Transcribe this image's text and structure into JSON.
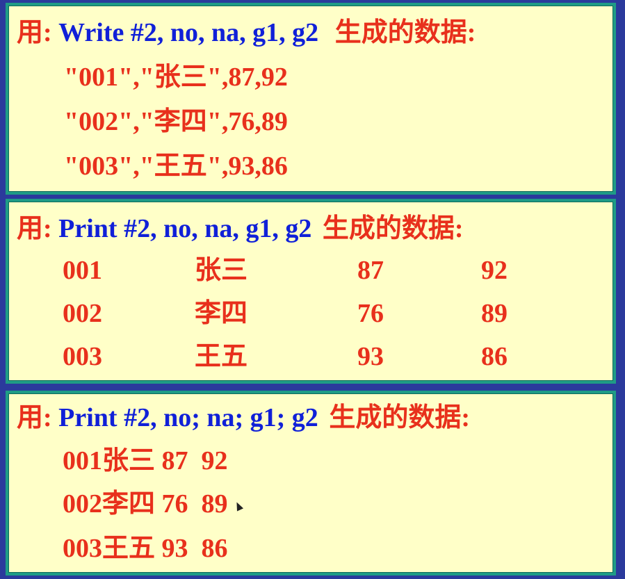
{
  "panels": [
    {
      "prefix": "用:",
      "command": "Write #2, no, na, g1, g2",
      "suffix": "生成的数据:",
      "lines": [
        "\"001\",\"张三\",87,92",
        "\"002\",\"李四\",76,89",
        "\"003\",\"王五\",93,86"
      ]
    },
    {
      "prefix": "用:",
      "command": "Print #2, no, na, g1, g2",
      "suffix": "生成的数据:",
      "rows": [
        [
          "001",
          "张三",
          "87",
          "92"
        ],
        [
          "002",
          "李四",
          "76",
          "89"
        ],
        [
          "003",
          "王五",
          "93",
          "86"
        ]
      ]
    },
    {
      "prefix": "用:",
      "command": "Print #2, no; na; g1; g2",
      "suffix": "生成的数据:",
      "lines": [
        "001张三 87  92",
        "002李四 76  89",
        "003王五 93  86"
      ]
    }
  ]
}
